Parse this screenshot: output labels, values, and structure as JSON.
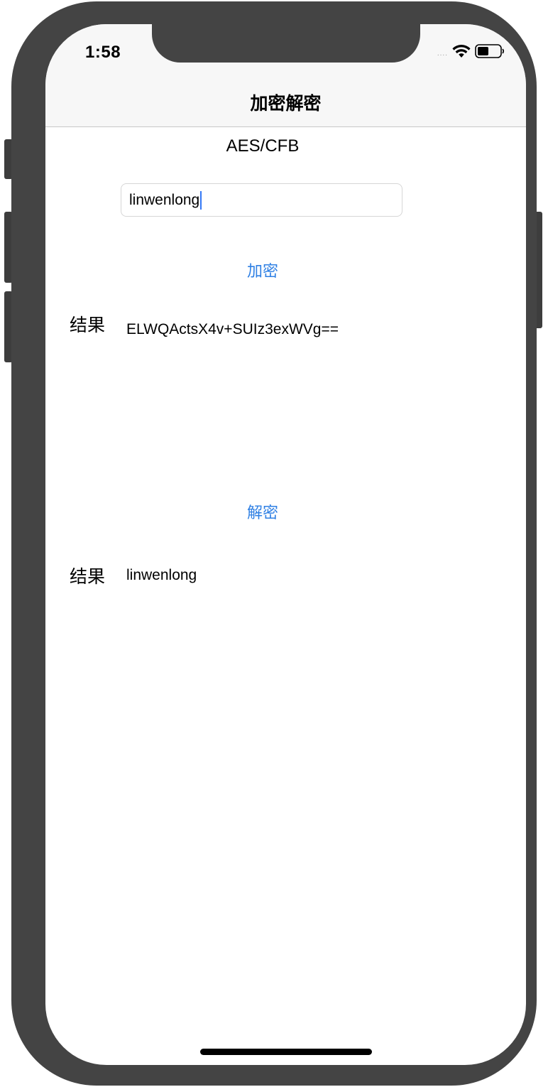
{
  "status_bar": {
    "time": "1:58",
    "signal": "....",
    "wifi_icon": "wifi-icon",
    "battery_icon": "battery-icon"
  },
  "nav": {
    "title": "加密解密"
  },
  "main": {
    "algorithm": "AES/CFB",
    "input": {
      "value": "linwenlong",
      "placeholder": ""
    },
    "encrypt_button": "加密",
    "encrypt_result_label": "结果",
    "encrypt_result_value": "ELWQActsX4v+SUIz3exWVg==",
    "decrypt_button": "解密",
    "decrypt_result_label": "结果",
    "decrypt_result_value": "linwenlong"
  },
  "colors": {
    "accent": "#2f80e4",
    "caret": "#3478f6",
    "frame": "#444444"
  }
}
